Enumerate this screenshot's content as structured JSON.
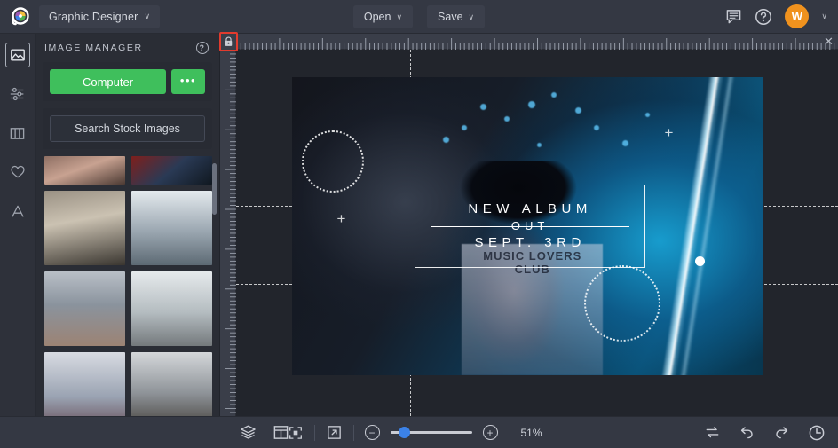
{
  "app": {
    "logo_name": "befunky-logo",
    "project_menu": {
      "label": "Graphic Designer",
      "caret": "∨"
    }
  },
  "topbar": {
    "open_label": "Open",
    "save_label": "Save",
    "caret": "∨",
    "feedback_icon": "chat-icon",
    "help_icon": "help-icon",
    "avatar_initial": "W",
    "avatar_color": "#f0921e"
  },
  "rail": {
    "items": [
      {
        "name": "image-tool",
        "icon": "image-icon",
        "active": true
      },
      {
        "name": "adjust-tool",
        "icon": "sliders-icon",
        "active": false
      },
      {
        "name": "layout-tool",
        "icon": "columns-icon",
        "active": false
      },
      {
        "name": "favorites-tool",
        "icon": "heart-icon",
        "active": false
      },
      {
        "name": "text-tool",
        "icon": "text-a-icon",
        "active": false
      }
    ]
  },
  "panel": {
    "title": "IMAGE MANAGER",
    "help_icon": "question-mark-icon",
    "computer_label": "Computer",
    "more_label": "•••",
    "search_stock_label": "Search Stock Images",
    "thumbnails": [
      {
        "alt": "city-rooftops",
        "c1": "#8e6f63",
        "c2": "#c8a291",
        "c3": "#4c3a33"
      },
      {
        "alt": "bridge-red-buildings",
        "c1": "#7e1f1c",
        "c2": "#2a3a55",
        "c3": "#101820"
      },
      {
        "alt": "woman-on-balcony",
        "c1": "#8b7f72",
        "c2": "#c9bfae",
        "c3": "#3a3630"
      },
      {
        "alt": "city-skyline-towers",
        "c1": "#cfd6dc",
        "c2": "#97a3ad",
        "c3": "#5d6a74"
      },
      {
        "alt": "waterfront-winter-bench",
        "c1": "#b9bfc7",
        "c2": "#7d8792",
        "c3": "#9c8374"
      },
      {
        "alt": "snowy-house-mountain",
        "c1": "#e2e6e8",
        "c2": "#b4bcc0",
        "c3": "#6e777b"
      },
      {
        "alt": "snowy-path-trees",
        "c1": "#d8dbe2",
        "c2": "#9aa3b2",
        "c3": "#6b5560"
      },
      {
        "alt": "winter-street-trees",
        "c1": "#d4d7da",
        "c2": "#8e9398",
        "c3": "#4a4642"
      }
    ]
  },
  "canvas": {
    "lock_icon": "lock-icon",
    "lock_highlighted": true,
    "close_ruler_label": "✕",
    "artwork": {
      "line1": "NEW ALBUM",
      "line2": "OUT",
      "line3": "SEPT. 3RD",
      "shirt_text": "MUSIC LOVERS CLUB",
      "plus_marks": [
        "+",
        "+"
      ]
    }
  },
  "bottombar": {
    "layers_icon": "layers-icon",
    "template_icon": "template-icon",
    "fit_icon": "fit-to-screen-icon",
    "expand_icon": "expand-icon",
    "zoom_out_label": "−",
    "zoom_in_label": "+",
    "zoom_value": "51%",
    "zoom_percent": 51,
    "compare_icon": "compare-swap-icon",
    "undo_icon": "undo-icon",
    "redo_icon": "redo-icon",
    "history_icon": "history-clock-icon"
  }
}
